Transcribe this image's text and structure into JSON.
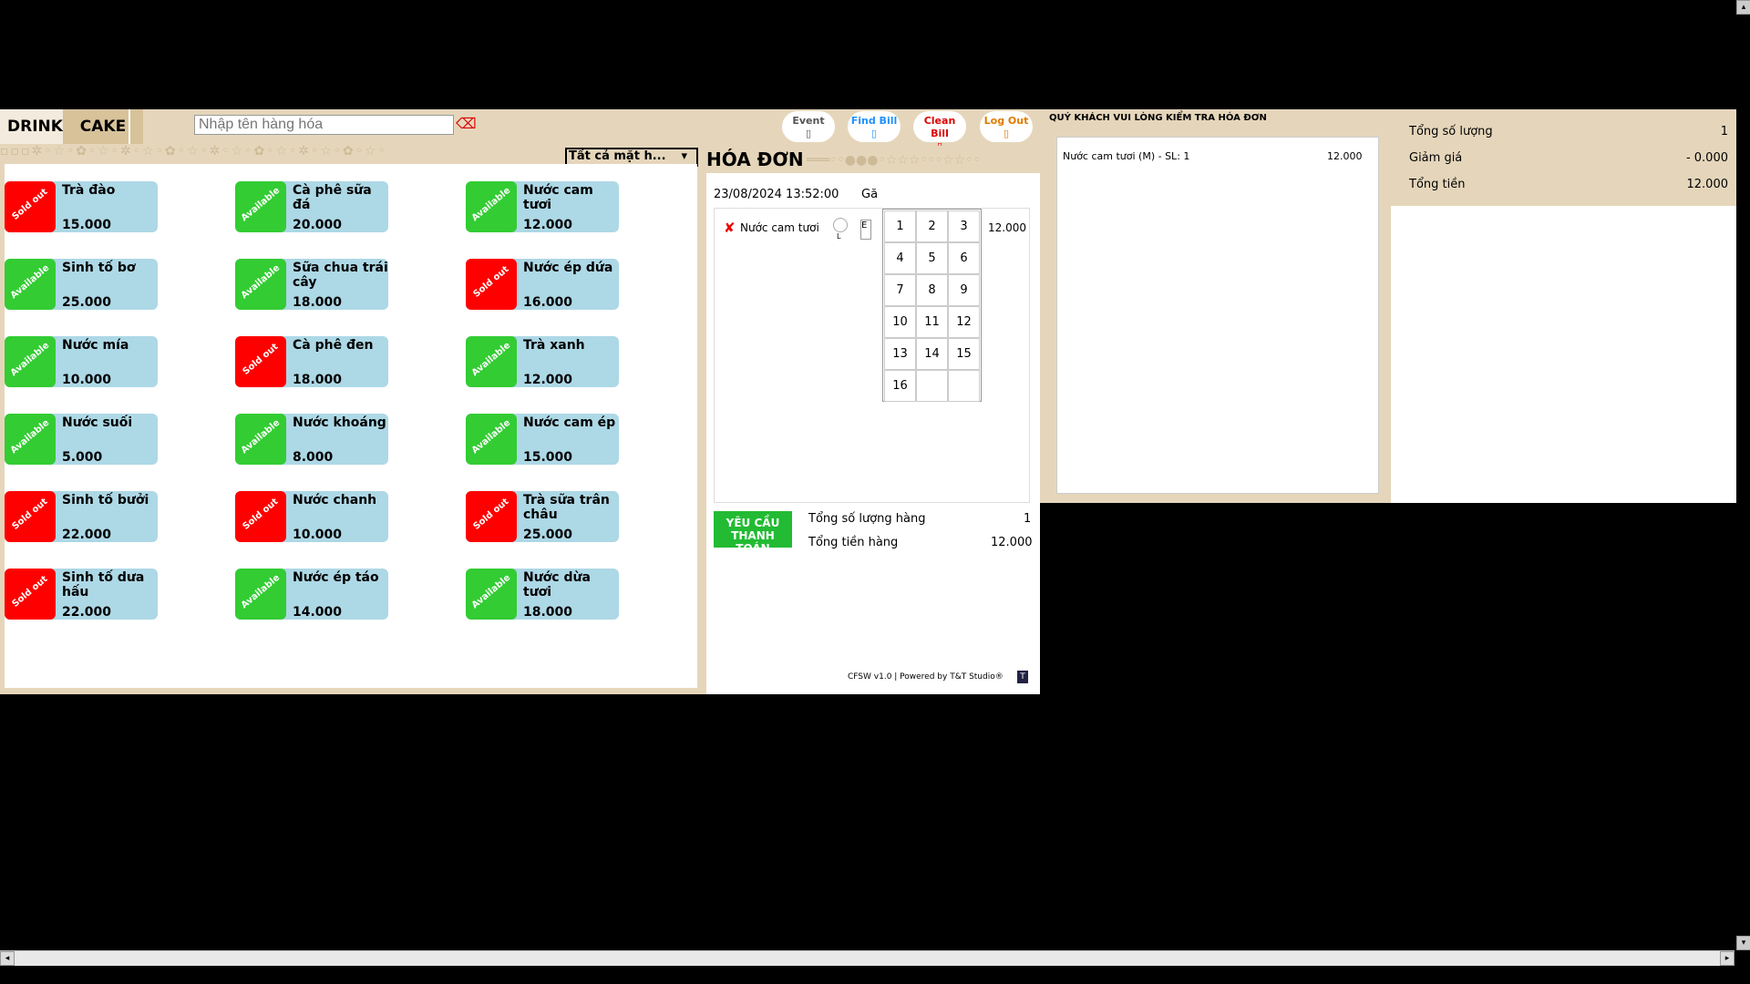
{
  "tabs": {
    "drink": "DRINK",
    "cake": "CAKE"
  },
  "search": {
    "placeholder": "Nhập tên hàng hóa",
    "clear_icon": "clear-icon"
  },
  "filter": {
    "selected": "Tất cả mặt h..."
  },
  "header_buttons": [
    {
      "label": "Event",
      "color": "#555555",
      "icon": "gift-icon"
    },
    {
      "label": "Find Bill",
      "color": "#1e90ff",
      "icon": "search-icon"
    },
    {
      "label": "Clean Bill",
      "color": "#dd0000",
      "icon": "trash-icon"
    },
    {
      "label": "Log Out",
      "color": "#e07b00",
      "icon": "logout-icon"
    }
  ],
  "menu": [
    {
      "name": "Trà đào",
      "price": "15.000",
      "status": "Sold out"
    },
    {
      "name": "Cà phê sữa đá",
      "price": "20.000",
      "status": "Available"
    },
    {
      "name": "Nước cam tươi",
      "price": "12.000",
      "status": "Available"
    },
    {
      "name": "Sinh tố bơ",
      "price": "25.000",
      "status": "Available"
    },
    {
      "name": "Sữa chua trái cây",
      "price": "18.000",
      "status": "Available"
    },
    {
      "name": "Nước ép dứa",
      "price": "16.000",
      "status": "Sold out"
    },
    {
      "name": "Nước mía",
      "price": "10.000",
      "status": "Available"
    },
    {
      "name": "Cà phê đen",
      "price": "18.000",
      "status": "Sold out"
    },
    {
      "name": "Trà xanh",
      "price": "12.000",
      "status": "Available"
    },
    {
      "name": "Nước suối",
      "price": "5.000",
      "status": "Available"
    },
    {
      "name": "Nước khoáng",
      "price": "8.000",
      "status": "Available"
    },
    {
      "name": "Nước cam ép",
      "price": "15.000",
      "status": "Available"
    },
    {
      "name": "Sinh tố bưởi",
      "price": "22.000",
      "status": "Sold out"
    },
    {
      "name": "Nước chanh",
      "price": "10.000",
      "status": "Sold out"
    },
    {
      "name": "Trà sữa trân châu",
      "price": "25.000",
      "status": "Sold out"
    },
    {
      "name": "Sinh tố dưa hấu",
      "price": "22.000",
      "status": "Sold out"
    },
    {
      "name": "Nước ép táo",
      "price": "14.000",
      "status": "Available"
    },
    {
      "name": "Nước dừa tươi",
      "price": "18.000",
      "status": "Available"
    }
  ],
  "bill": {
    "title": "HÓA ĐƠN",
    "datetime": "23/08/2024 13:52:00",
    "gan_label": "Gă",
    "line": {
      "name": "Nước cam tươi",
      "size": "L",
      "box": "E",
      "price": "12.000"
    },
    "numpad": [
      "1",
      "2",
      "3",
      "4",
      "5",
      "6",
      "7",
      "8",
      "9",
      "10",
      "11",
      "12",
      "13",
      "14",
      "15",
      "16",
      "",
      ""
    ],
    "pay_button": "YÊU CẦU THANH TOÁN",
    "qty_label": "Tổng số lượng hàng",
    "qty_value": "1",
    "total_label": "Tổng tiền hàng",
    "total_value": "12.000",
    "footer": "CFSW v1.0  |  Powered by T&T Studio®"
  },
  "customer": {
    "title": "QUÝ KHÁCH VUI LÒNG KIỂM TRA HÓA ĐƠN",
    "item": "Nước cam tươi (M)   -   SL: 1",
    "item_price": "12.000",
    "summary": [
      {
        "label": "Tổng số lượng",
        "value": "1"
      },
      {
        "label": "Giảm giá",
        "value": "- 0.000"
      },
      {
        "label": "Tổng tiền",
        "value": "12.000"
      }
    ]
  }
}
